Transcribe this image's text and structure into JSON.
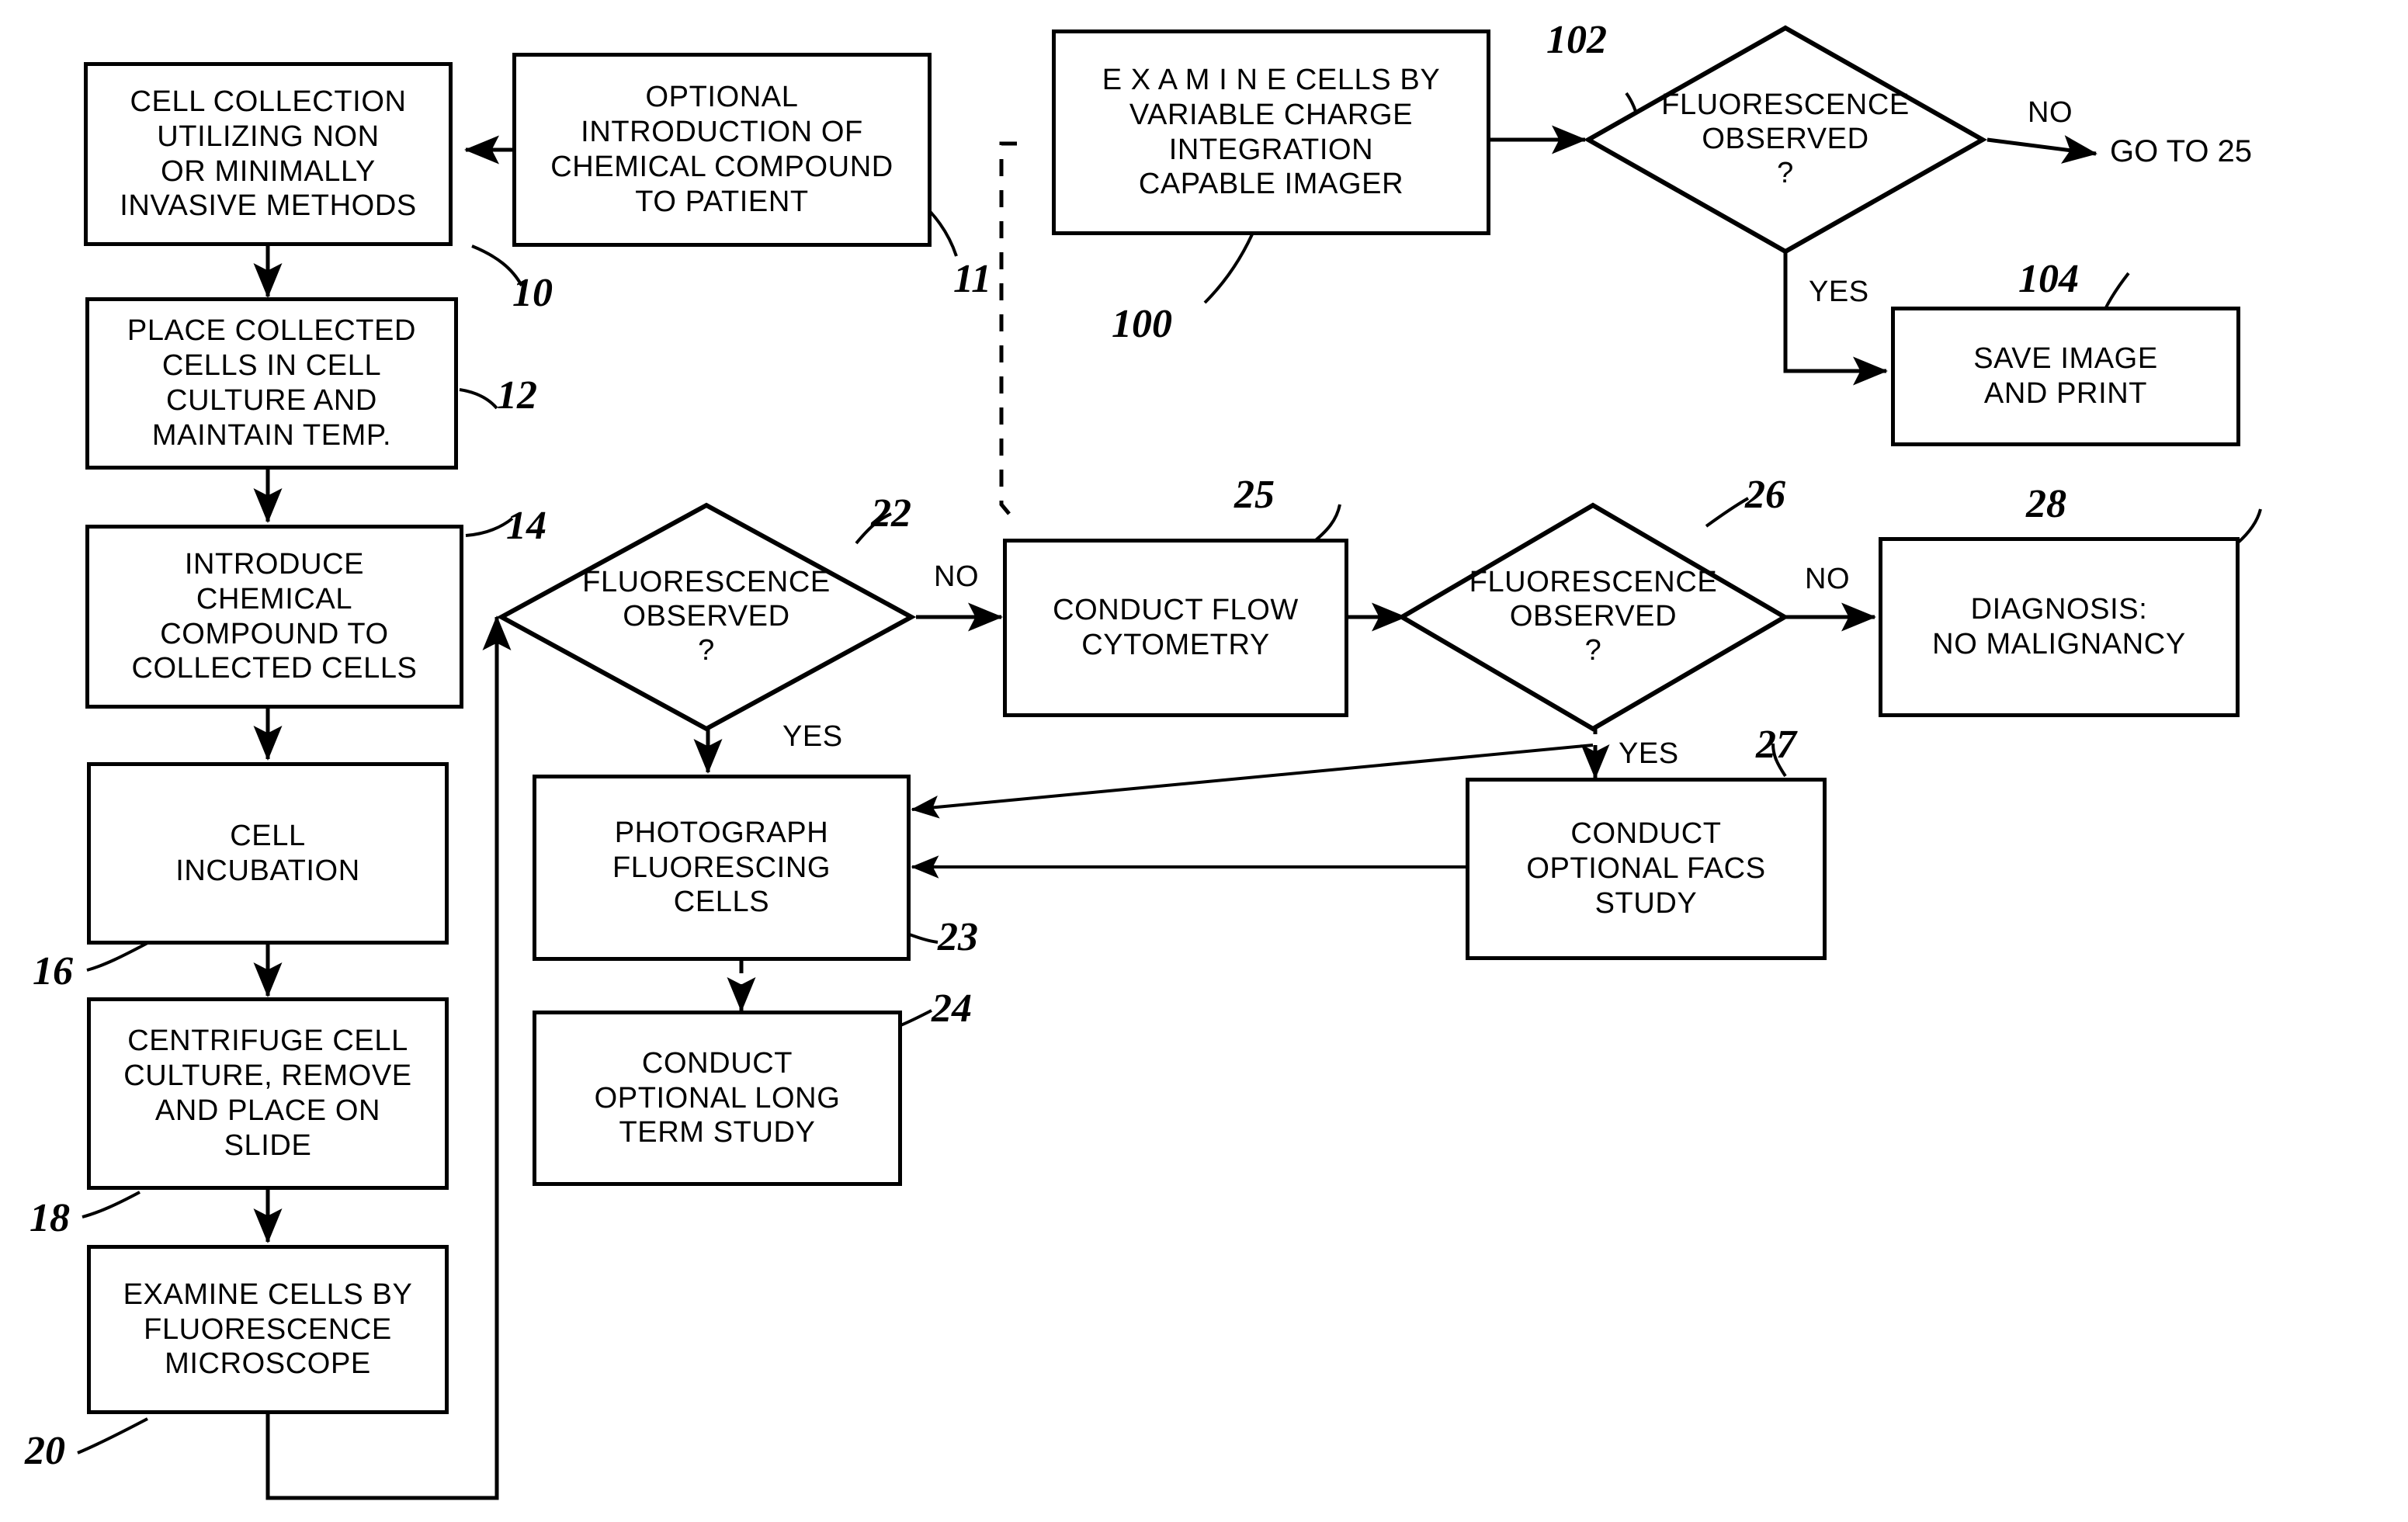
{
  "figure": {
    "kind": "patent-flowchart",
    "background": "#ffffff",
    "ink": "#000000"
  },
  "nodes": {
    "cell_collection": {
      "lines": [
        "CELL COLLECTION",
        "UTILIZING  NON",
        "OR MINIMALLY",
        "INVASIVE METHODS"
      ]
    },
    "optional_intro": {
      "lines": [
        "OPTIONAL",
        "INTRODUCTION OF",
        "CHEMICAL COMPOUND",
        "TO PATIENT"
      ]
    },
    "examine_imager": {
      "lines": [
        "E X A M I N E  CELLS BY",
        "VARIABLE CHARGE",
        "INTEGRATION",
        "CAPABLE IMAGER"
      ]
    },
    "place_collected": {
      "lines": [
        "PLACE COLLECTED",
        "CELLS IN CELL",
        "CULTURE  AND",
        "MAINTAIN TEMP."
      ]
    },
    "introduce_chemical": {
      "lines": [
        "INTRODUCE",
        "CHEMICAL",
        "COMPOUND  TO",
        "COLLECTED CELLS"
      ]
    },
    "cell_incubation": {
      "lines": [
        "CELL",
        "INCUBATION"
      ]
    },
    "centrifuge": {
      "lines": [
        "CENTRIFUGE  CELL",
        "CULTURE, REMOVE",
        "AND PLACE ON",
        "SLIDE"
      ]
    },
    "examine_microscope": {
      "lines": [
        "EXAMINE CELLS BY",
        "FLUORESCENCE",
        "MICROSCOPE"
      ]
    },
    "save_image": {
      "lines": [
        "SAVE IMAGE",
        "AND PRINT"
      ]
    },
    "conduct_flow": {
      "lines": [
        "CONDUCT FLOW",
        "CYTOMETRY"
      ]
    },
    "diagnosis": {
      "lines": [
        "DIAGNOSIS:",
        "NO MALIGNANCY"
      ]
    },
    "photograph": {
      "lines": [
        "PHOTOGRAPH",
        "FLUORESCING",
        "CELLS"
      ]
    },
    "long_term": {
      "lines": [
        "CONDUCT",
        "OPTIONAL LONG",
        "TERM STUDY"
      ]
    },
    "facs": {
      "lines": [
        "CONDUCT",
        "OPTIONAL FACS",
        "STUDY"
      ]
    },
    "decision_102": {
      "lines": [
        "FLUORESCENCE",
        "OBSERVED",
        "?"
      ]
    },
    "decision_22": {
      "lines": [
        "FLUORESCENCE",
        "OBSERVED",
        "?"
      ]
    },
    "decision_26": {
      "lines": [
        "FLUORESCENCE",
        "OBSERVED",
        "?"
      ]
    }
  },
  "edge_labels": {
    "no_102": "NO",
    "yes_102": "YES",
    "no_22": "NO",
    "yes_22": "YES",
    "no_26": "NO",
    "yes_26": "YES"
  },
  "terminals": {
    "go_to_25": "GO TO 25"
  },
  "refs": {
    "r10": "10",
    "r11": "11",
    "r12": "12",
    "r14": "14",
    "r16": "16",
    "r18": "18",
    "r20": "20",
    "r22": "22",
    "r23": "23",
    "r24": "24",
    "r25": "25",
    "r26": "26",
    "r27": "27",
    "r28": "28",
    "r100": "100",
    "r102": "102",
    "r104": "104"
  }
}
